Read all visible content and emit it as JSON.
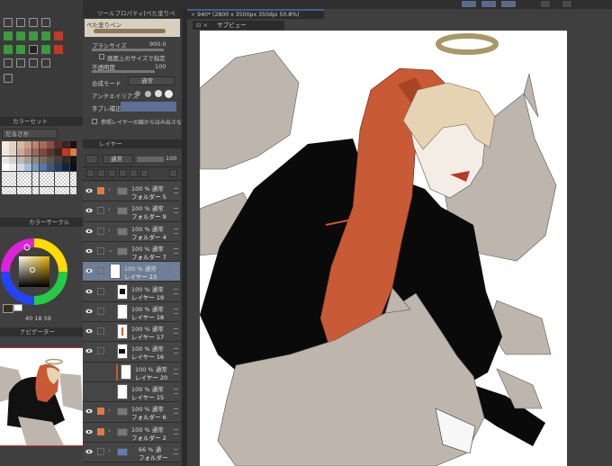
{
  "tool_property": {
    "title": "ツールプロパティ[べた塗りペン]",
    "brush_name": "べた塗りペン",
    "brush_size_label": "ブラシサイズ",
    "brush_size_value": "900.0",
    "canvas_size_option": "画面上のサイズで指定",
    "opacity_label": "不透明度",
    "opacity_value": "100",
    "blend_label": "合成モード",
    "blend_value": "通常",
    "antialias_label": "アンチエイリアス",
    "stabilizer_label": "手ブレ補正",
    "ref_option": "参照レイヤーの線からはみ出さない"
  },
  "colorset": {
    "title": "カラーセット",
    "preset": "だるさか"
  },
  "colorwheel": {
    "title": "カラーサークル",
    "readout": "40 18 59"
  },
  "navigator": {
    "title": "ナビゲーター"
  },
  "layers_panel": {
    "title": "レイヤー",
    "blend": "通常",
    "opacity": "100",
    "rows": [
      {
        "l1": "100 % 通常",
        "l2": "フォルダー 5",
        "kind": "folder",
        "lock": true,
        "selected": false
      },
      {
        "l1": "100 % 通常",
        "l2": "フォルダー 9",
        "kind": "folder",
        "lock": false,
        "selected": false
      },
      {
        "l1": "100 % 通常",
        "l2": "フォルダー 4",
        "kind": "folder",
        "lock": false,
        "selected": false
      },
      {
        "l1": "100 % 通常",
        "l2": "フォルダー 7",
        "kind": "folder",
        "lock": false,
        "selected": false
      },
      {
        "l1": "100 % 通常",
        "l2": "レイヤー 23",
        "kind": "layer",
        "lock": false,
        "selected": true
      },
      {
        "l1": "100 % 通常",
        "l2": "レイヤー 19",
        "kind": "layer",
        "lock": false,
        "selected": false
      },
      {
        "l1": "100 % 通常",
        "l2": "レイヤー 18",
        "kind": "layer",
        "lock": false,
        "selected": false
      },
      {
        "l1": "100 % 通常",
        "l2": "レイヤー 17",
        "kind": "layer",
        "lock": false,
        "selected": false
      },
      {
        "l1": "100 % 通常",
        "l2": "レイヤー 16",
        "kind": "layer",
        "lock": false,
        "selected": false
      },
      {
        "l1": "100 % 通常",
        "l2": "レイヤー 20",
        "kind": "layer",
        "lock": false,
        "selected": false
      },
      {
        "l1": "100 % 通常",
        "l2": "レイヤー 15",
        "kind": "layer",
        "lock": false,
        "selected": false
      },
      {
        "l1": "100 % 通常",
        "l2": "フォルダー 6",
        "kind": "folder",
        "lock": true,
        "selected": false
      },
      {
        "l1": "100 % 通常",
        "l2": "フォルダー 2",
        "kind": "folder",
        "lock": true,
        "selected": false
      },
      {
        "l1": "66 % 通",
        "l2": "フォルダー",
        "kind": "folder",
        "lock": false,
        "selected": false
      }
    ]
  },
  "canvas": {
    "tab_label": "940* (2800 x 3500px 350dpi 50.8%)",
    "subview_label": "サブビュー"
  },
  "colors": {
    "accent": "#e07a45",
    "hood": "#c85a36",
    "wolf": "#beb5ad",
    "selected_layer": "#6f7e96",
    "halo": "#a89868"
  }
}
